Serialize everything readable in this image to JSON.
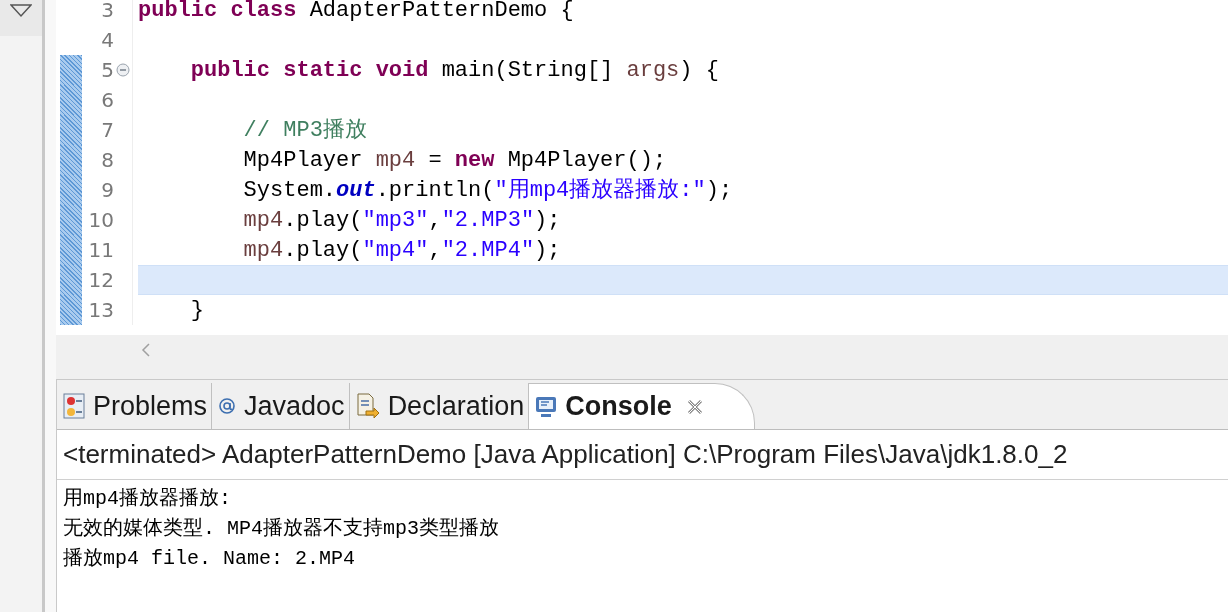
{
  "editor": {
    "lines": [
      {
        "number": "3",
        "changed": false,
        "current": false,
        "collapsible": false,
        "tokens": [
          {
            "text": "public class",
            "kind": "keyword"
          },
          {
            "text": " AdapterPatternDemo {",
            "kind": "plain"
          }
        ]
      },
      {
        "number": "4",
        "changed": false,
        "current": false,
        "collapsible": false
      },
      {
        "number": "5",
        "changed": true,
        "current": false,
        "collapsible": true,
        "tokens": [
          {
            "text": "    public static void",
            "kind": "keyword"
          },
          {
            "text": " main(String[] ",
            "kind": "plain"
          },
          {
            "text": "args",
            "kind": "local"
          },
          {
            "text": ") {",
            "kind": "plain"
          }
        ]
      },
      {
        "number": "6",
        "changed": true,
        "current": false,
        "collapsible": false
      },
      {
        "number": "7",
        "changed": true,
        "current": false,
        "collapsible": false,
        "tokens": [
          {
            "text": "        // MP3播放",
            "kind": "comment"
          }
        ]
      },
      {
        "number": "8",
        "changed": true,
        "current": false,
        "collapsible": false,
        "tokens": [
          {
            "text": "        Mp4Player ",
            "kind": "plain"
          },
          {
            "text": "mp4",
            "kind": "local"
          },
          {
            "text": " = ",
            "kind": "plain"
          },
          {
            "text": "new",
            "kind": "keyword"
          },
          {
            "text": " Mp4Player();",
            "kind": "plain"
          }
        ]
      },
      {
        "number": "9",
        "changed": true,
        "current": false,
        "collapsible": false,
        "tokens": [
          {
            "text": "        System.",
            "kind": "plain"
          },
          {
            "text": "out",
            "kind": "field"
          },
          {
            "text": ".println(",
            "kind": "plain"
          },
          {
            "text": "\"用mp4播放器播放:\"",
            "kind": "string"
          },
          {
            "text": ");",
            "kind": "plain"
          }
        ]
      },
      {
        "number": "10",
        "changed": true,
        "current": false,
        "collapsible": false,
        "tokens": [
          {
            "text": "        mp4",
            "kind": "local"
          },
          {
            "text": ".play(",
            "kind": "plain"
          },
          {
            "text": "\"mp3\"",
            "kind": "string"
          },
          {
            "text": ",",
            "kind": "plain"
          },
          {
            "text": "\"2.MP3\"",
            "kind": "string"
          },
          {
            "text": ");",
            "kind": "plain"
          }
        ]
      },
      {
        "number": "11",
        "changed": true,
        "current": false,
        "collapsible": false,
        "tokens": [
          {
            "text": "        mp4",
            "kind": "local"
          },
          {
            "text": ".play(",
            "kind": "plain"
          },
          {
            "text": "\"mp4\"",
            "kind": "string"
          },
          {
            "text": ",",
            "kind": "plain"
          },
          {
            "text": "\"2.MP4\"",
            "kind": "string"
          },
          {
            "text": ");",
            "kind": "plain"
          }
        ]
      },
      {
        "number": "12",
        "changed": true,
        "current": true,
        "collapsible": false
      },
      {
        "number": "13",
        "changed": true,
        "current": false,
        "collapsible": false,
        "tokens": [
          {
            "text": "    }",
            "kind": "plain"
          }
        ]
      }
    ]
  },
  "views": {
    "tabs": [
      {
        "label": "Problems",
        "selected": false,
        "closable": false
      },
      {
        "label": "Javadoc",
        "selected": false,
        "closable": false
      },
      {
        "label": "Declaration",
        "selected": false,
        "closable": false
      },
      {
        "label": "Console",
        "selected": true,
        "closable": true
      }
    ],
    "console": {
      "title": "<terminated> AdapterPatternDemo [Java Application] C:\\Program Files\\Java\\jdk1.8.0_2",
      "output": [
        "用mp4播放器播放:",
        "无效的媒体类型. MP4播放器不支持mp3类型播放",
        "播放mp4 file. Name: 2.MP4"
      ]
    }
  }
}
